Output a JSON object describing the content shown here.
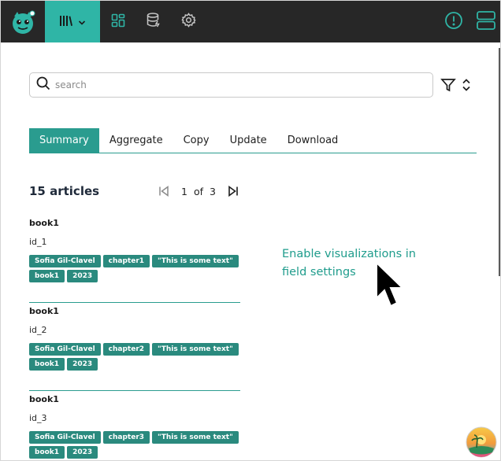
{
  "search": {
    "placeholder": "search",
    "value": ""
  },
  "tabs": [
    {
      "label": "Summary",
      "active": true
    },
    {
      "label": "Aggregate",
      "active": false
    },
    {
      "label": "Copy",
      "active": false
    },
    {
      "label": "Update",
      "active": false
    },
    {
      "label": "Download",
      "active": false
    }
  ],
  "results": {
    "count_label": "15 articles",
    "page": "1",
    "of": "of",
    "total_pages": "3"
  },
  "articles": [
    {
      "title": "book1",
      "id": "id_1",
      "tags": [
        "Sofia Gil-Clavel",
        "chapter1",
        "\"This is some text\"",
        "book1",
        "2023"
      ]
    },
    {
      "title": "book1",
      "id": "id_2",
      "tags": [
        "Sofia Gil-Clavel",
        "chapter2",
        "\"This is some text\"",
        "book1",
        "2023"
      ]
    },
    {
      "title": "book1",
      "id": "id_3",
      "tags": [
        "Sofia Gil-Clavel",
        "chapter3",
        "\"This is some text\"",
        "book1",
        "2023"
      ]
    }
  ],
  "notice": "Enable visualizations in field settings",
  "colors": {
    "nav_bg": "#272727",
    "accent": "#2fb5a6",
    "tab_active": "#2a9c8f",
    "chip": "#2a8a7e",
    "notice": "#1f9c8c"
  },
  "icons": [
    "robot-logo-icon",
    "library-icon",
    "chevron-down-icon",
    "dashboard-icon",
    "database-icon",
    "gear-icon",
    "alert-circle-icon",
    "servers-icon",
    "search-icon",
    "filter-icon",
    "sort-icon",
    "first-page-icon",
    "last-page-icon",
    "cursor-icon",
    "app-badge-icon"
  ]
}
